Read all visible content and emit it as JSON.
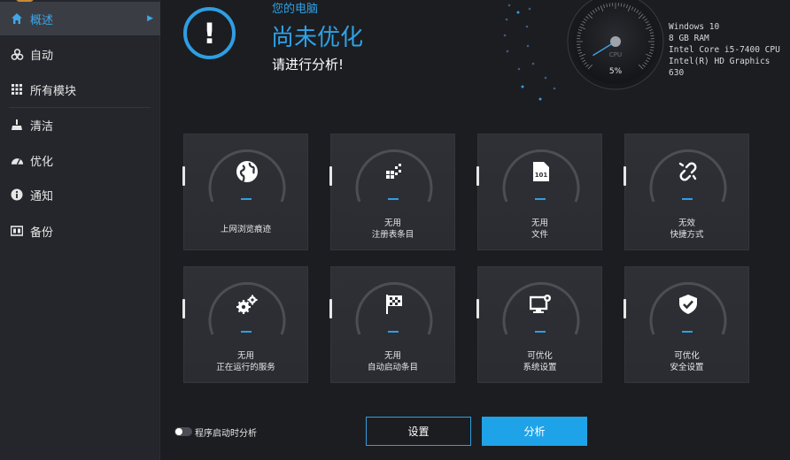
{
  "sidebar": {
    "items": [
      {
        "label": "概述",
        "icon": "home-icon"
      },
      {
        "label": "自动",
        "icon": "biohazard-icon"
      },
      {
        "label": "所有模块",
        "icon": "grid-icon"
      },
      {
        "label": "清洁",
        "icon": "broom-icon"
      },
      {
        "label": "优化",
        "icon": "gauge-icon"
      },
      {
        "label": "通知",
        "icon": "info-icon"
      },
      {
        "label": "备份",
        "icon": "backup-icon"
      }
    ]
  },
  "header": {
    "status_symbol": "!",
    "subtitle": "您的电脑",
    "title": "尚未优化",
    "hint": "请进行分析!"
  },
  "gauge": {
    "label": "CPU",
    "value": "5%",
    "fraction": 0.05
  },
  "system_info": {
    "os": "Windows 10",
    "ram": "8 GB RAM",
    "cpu": "Intel Core i5-7400 CPU",
    "gpu": "Intel(R) HD Graphics 630"
  },
  "tiles": [
    {
      "lines": [
        "上网浏览痕迹"
      ],
      "icon": "globe-icon",
      "value": "–"
    },
    {
      "lines": [
        "无用",
        "注册表条目"
      ],
      "icon": "registry-icon",
      "value": "–"
    },
    {
      "lines": [
        "无用",
        "文件"
      ],
      "icon": "file-icon",
      "value": "–"
    },
    {
      "lines": [
        "无效",
        "快捷方式"
      ],
      "icon": "broken-link-icon",
      "value": "–"
    },
    {
      "lines": [
        "无用",
        "正在运行的服务"
      ],
      "icon": "gears-icon",
      "value": "–"
    },
    {
      "lines": [
        "无用",
        "自动启动条目"
      ],
      "icon": "flag-icon",
      "value": "–"
    },
    {
      "lines": [
        "可优化",
        "系统设置"
      ],
      "icon": "monitor-settings-icon",
      "value": "–"
    },
    {
      "lines": [
        "可优化",
        "安全设置"
      ],
      "icon": "shield-check-icon",
      "value": "–"
    }
  ],
  "footer": {
    "toggle_label": "程序启动时分析",
    "toggle_on": false,
    "settings_button": "设置",
    "analyze_button": "分析"
  },
  "colors": {
    "accent": "#2f9ee2",
    "analyze": "#1fa3e8",
    "background": "#1c1d21",
    "sidebar": "#24262b",
    "tile": "#2e3036"
  }
}
